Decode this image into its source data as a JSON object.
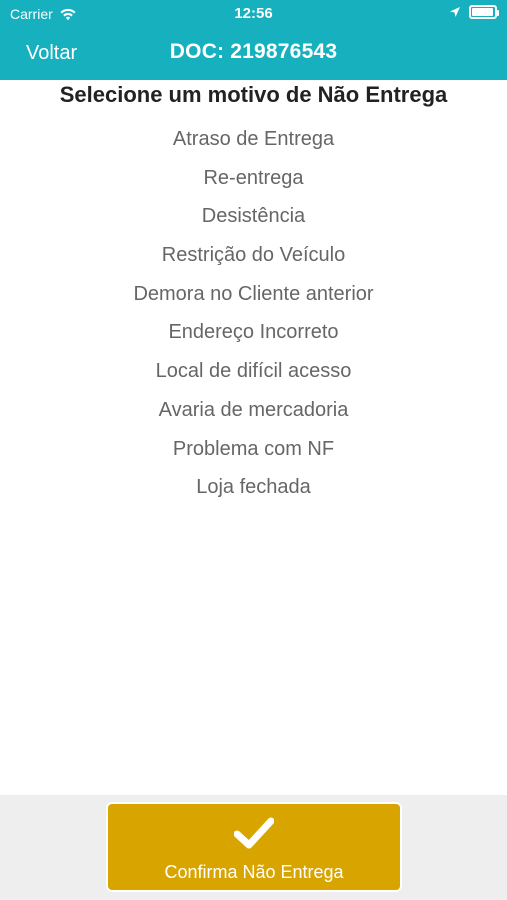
{
  "status_bar": {
    "carrier": "Carrier",
    "time": "12:56",
    "wifi_icon": "wifi-icon",
    "location_icon": "location-arrow-icon",
    "battery_icon": "battery-icon"
  },
  "nav": {
    "back_label": "Voltar",
    "title": "DOC: 219876543"
  },
  "heading": "Selecione um motivo de Não Entrega",
  "reasons": [
    "Atraso de Entrega",
    "Re-entrega",
    "Desistência",
    "Restrição do Veículo",
    "Demora no Cliente anterior",
    "Endereço Incorreto",
    "Local de difícil acesso",
    "Avaria de mercadoria",
    "Problema com NF",
    "Loja fechada"
  ],
  "footer": {
    "confirm_label": "Confirma Não Entrega",
    "confirm_icon": "checkmark-icon"
  },
  "colors": {
    "header": "#16b0bf",
    "confirm": "#d8a400",
    "footer_bg": "#eeeeee",
    "reason_text": "#666666"
  }
}
